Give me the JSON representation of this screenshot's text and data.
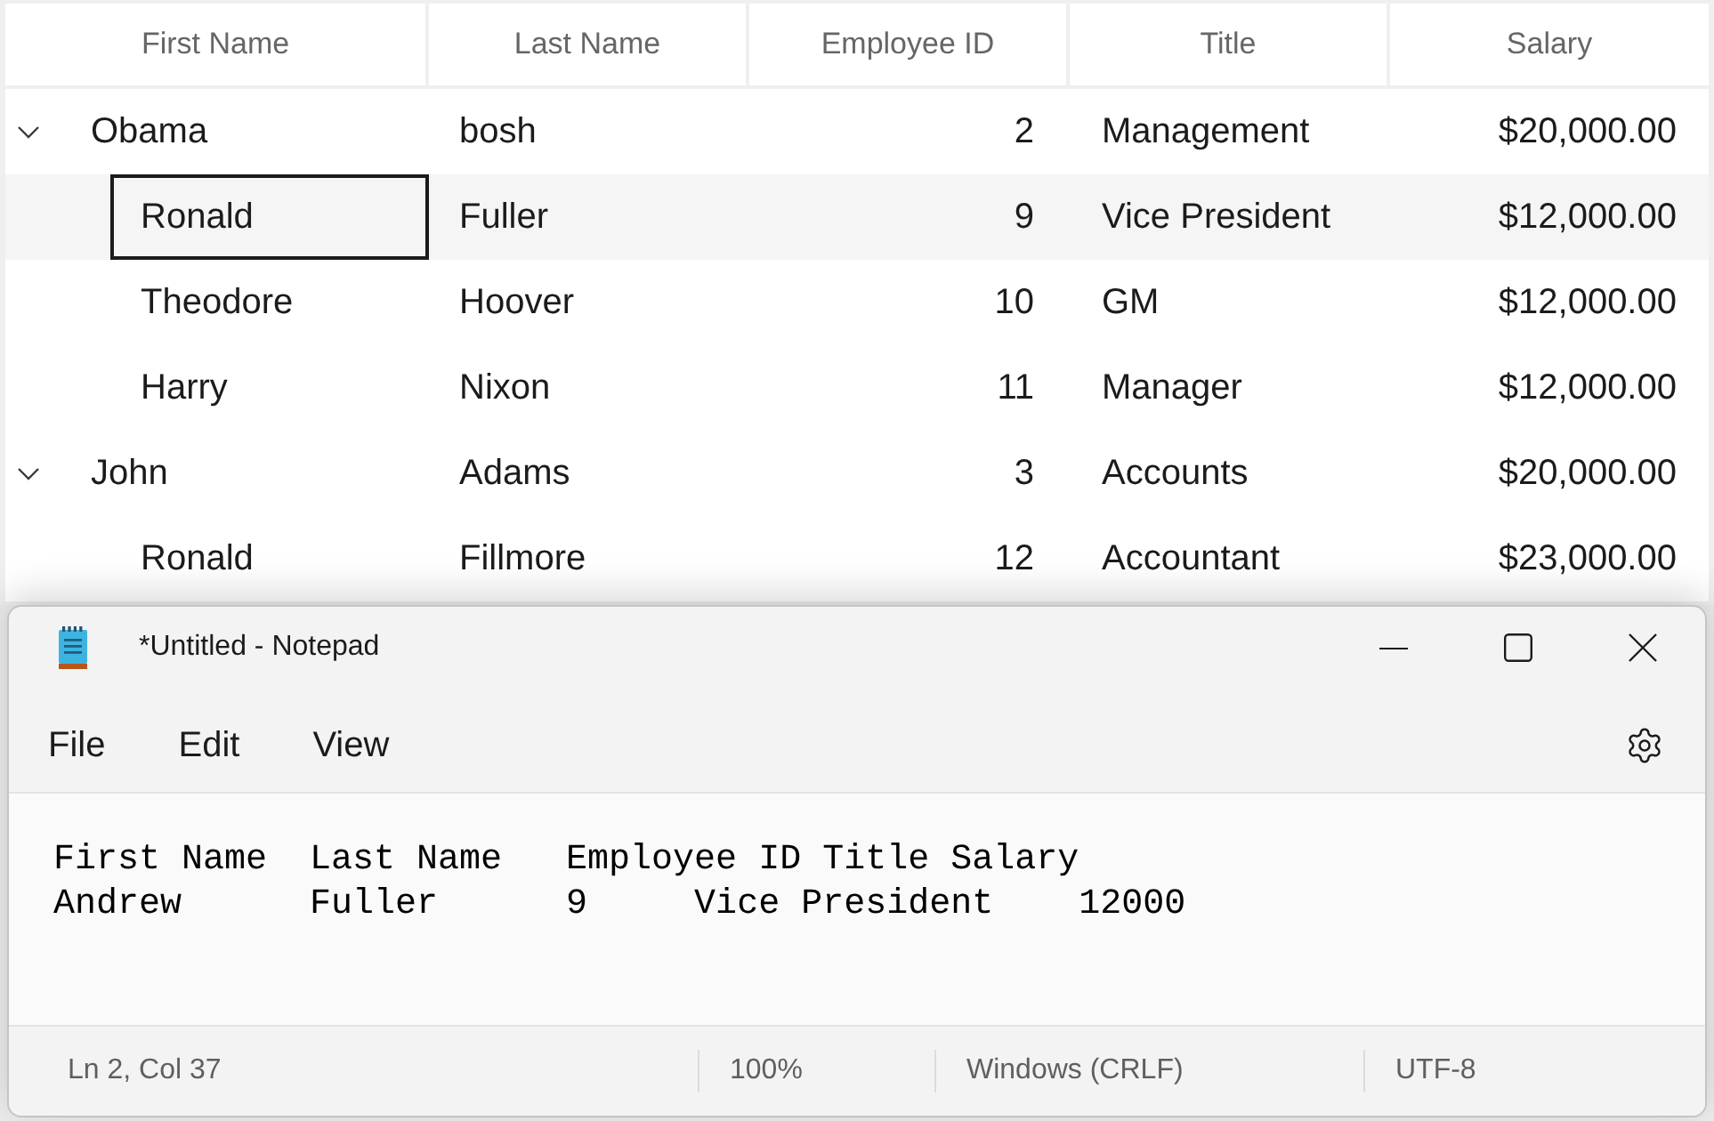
{
  "table": {
    "columns": [
      "First Name",
      "Last Name",
      "Employee ID",
      "Title",
      "Salary"
    ],
    "rows": [
      {
        "first_name": "Obama",
        "last_name": "bosh",
        "employee_id": "2",
        "title": "Management",
        "salary": "$20,000.00",
        "selected": false,
        "expanded": true,
        "children": [
          {
            "first_name": "Ronald",
            "last_name": "Fuller",
            "employee_id": "9",
            "title": "Vice President",
            "salary": "$12,000.00",
            "selected": true
          },
          {
            "first_name": "Theodore",
            "last_name": "Hoover",
            "employee_id": "10",
            "title": "GM",
            "salary": "$12,000.00",
            "selected": false
          },
          {
            "first_name": "Harry",
            "last_name": "Nixon",
            "employee_id": "11",
            "title": "Manager",
            "salary": "$12,000.00",
            "selected": false
          }
        ]
      },
      {
        "first_name": "John",
        "last_name": "Adams",
        "employee_id": "3",
        "title": "Accounts",
        "salary": "$20,000.00",
        "selected": false,
        "expanded": true,
        "children": [
          {
            "first_name": "Ronald",
            "last_name": "Fillmore",
            "employee_id": "12",
            "title": "Accountant",
            "salary": "$23,000.00",
            "selected": false
          }
        ]
      }
    ]
  },
  "notepad": {
    "title": "*Untitled - Notepad",
    "menu": [
      "File",
      "Edit",
      "View"
    ],
    "lines": [
      "First Name  Last Name   Employee ID Title Salary",
      "Andrew      Fuller      9     Vice President    12000"
    ],
    "status_bar": [
      "Ln 2, Col 37",
      "100%",
      "Windows (CRLF)",
      "UTF-8"
    ]
  }
}
